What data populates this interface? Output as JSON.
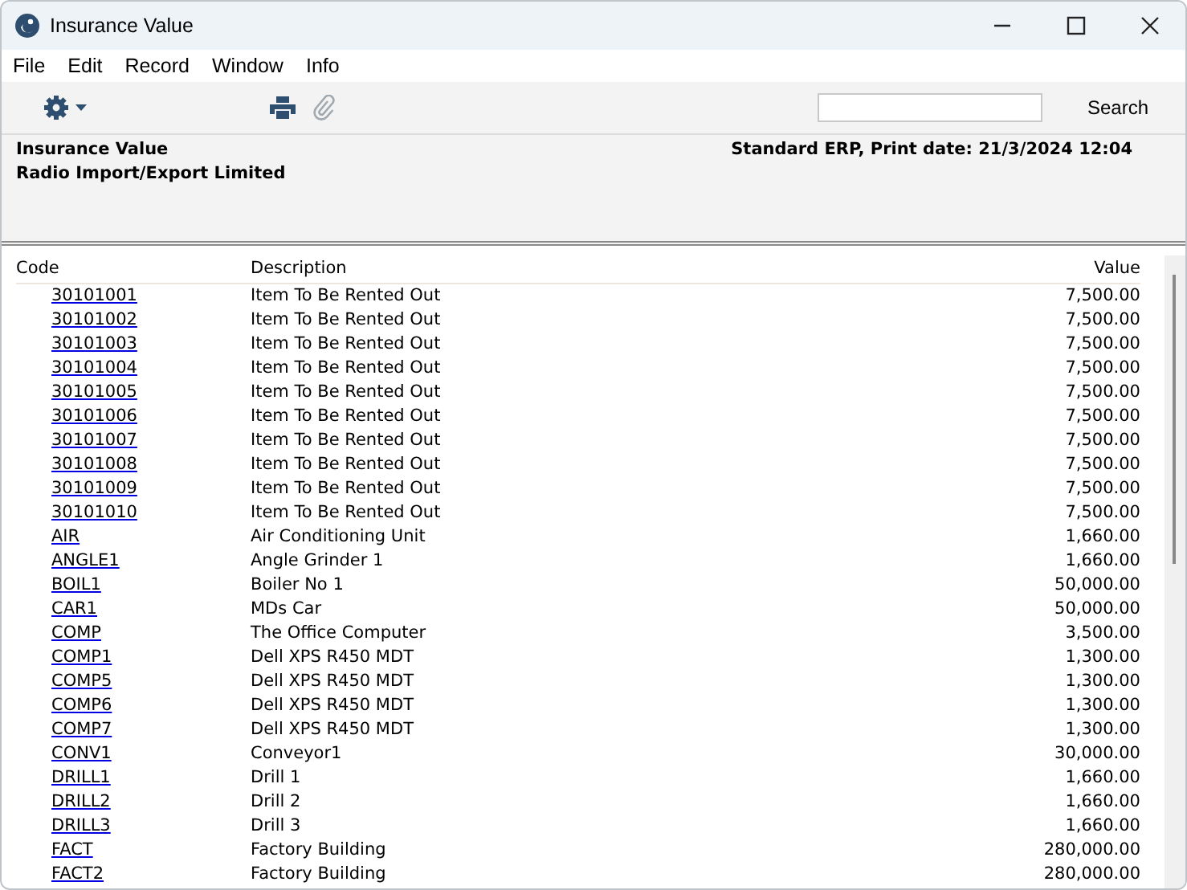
{
  "window": {
    "title": "Insurance Value"
  },
  "menu": [
    "File",
    "Edit",
    "Record",
    "Window",
    "Info"
  ],
  "search": {
    "button": "Search"
  },
  "header": {
    "title": "Insurance Value",
    "company": "Radio Import/Export Limited",
    "info": "Standard ERP, Print date: 21/3/2024 12:04"
  },
  "table": {
    "columns": [
      "Code",
      "Description",
      "Value"
    ],
    "rows": [
      [
        "30101001",
        "Item To Be Rented Out",
        "7,500.00"
      ],
      [
        "30101002",
        "Item To Be Rented Out",
        "7,500.00"
      ],
      [
        "30101003",
        "Item To Be Rented Out",
        "7,500.00"
      ],
      [
        "30101004",
        "Item To Be Rented Out",
        "7,500.00"
      ],
      [
        "30101005",
        "Item To Be Rented Out",
        "7,500.00"
      ],
      [
        "30101006",
        "Item To Be Rented Out",
        "7,500.00"
      ],
      [
        "30101007",
        "Item To Be Rented Out",
        "7,500.00"
      ],
      [
        "30101008",
        "Item To Be Rented Out",
        "7,500.00"
      ],
      [
        "30101009",
        "Item To Be Rented Out",
        "7,500.00"
      ],
      [
        "30101010",
        "Item To Be Rented Out",
        "7,500.00"
      ],
      [
        "AIR",
        "Air Conditioning Unit",
        "1,660.00"
      ],
      [
        "ANGLE1",
        "Angle Grinder 1",
        "1,660.00"
      ],
      [
        "BOIL1",
        "Boiler No 1",
        "50,000.00"
      ],
      [
        "CAR1",
        "MDs Car",
        "50,000.00"
      ],
      [
        "COMP",
        "The Office Computer",
        "3,500.00"
      ],
      [
        "COMP1",
        "Dell XPS R450 MDT",
        "1,300.00"
      ],
      [
        "COMP5",
        "Dell XPS R450 MDT",
        "1,300.00"
      ],
      [
        "COMP6",
        "Dell XPS R450 MDT",
        "1,300.00"
      ],
      [
        "COMP7",
        "Dell XPS R450 MDT",
        "1,300.00"
      ],
      [
        "CONV1",
        "Conveyor1",
        "30,000.00"
      ],
      [
        "DRILL1",
        "Drill 1",
        "1,660.00"
      ],
      [
        "DRILL2",
        "Drill 2",
        "1,660.00"
      ],
      [
        "DRILL3",
        "Drill 3",
        "1,660.00"
      ],
      [
        "FACT",
        "Factory Building",
        "280,000.00"
      ],
      [
        "FACT2",
        "Factory Building",
        "280,000.00"
      ]
    ]
  }
}
